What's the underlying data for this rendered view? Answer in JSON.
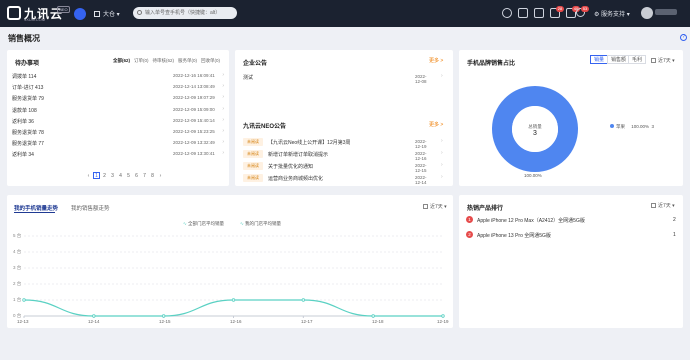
{
  "header": {
    "logo_text": "九讯云",
    "logo_sub": "9XUN.COM",
    "logo_badge": "NEO",
    "store_label": "大仓",
    "search_placeholder": "输入单号查手机号（快捷键：alt）",
    "badges": [
      "28",
      "40",
      "53"
    ],
    "service_label": "服务支持"
  },
  "page": {
    "title": "销售概况",
    "help": "?"
  },
  "todo": {
    "title": "待办事项",
    "tabs": [
      {
        "label": "全部(62)",
        "active": true
      },
      {
        "label": "订单(0)",
        "active": false
      },
      {
        "label": "待审核(62)",
        "active": false
      },
      {
        "label": "服务单(0)",
        "active": false
      },
      {
        "label": "回收单(0)",
        "active": false
      }
    ],
    "items": [
      {
        "label": "调拨单 114",
        "date": "2022-12-16 16:09:41"
      },
      {
        "label": "订单-进订 413",
        "date": "2022-12-14 13:08:49"
      },
      {
        "label": "服务退货单 79",
        "date": "2022-12-09 19:07:29"
      },
      {
        "label": "退款单 108",
        "date": "2022-12-09 15:09:00"
      },
      {
        "label": "返利单 36",
        "date": "2022-12-09 15:40:14"
      },
      {
        "label": "服务退货单 78",
        "date": "2022-12-09 15:23:25"
      },
      {
        "label": "服务退货单 77",
        "date": "2022-12-09 13:32:49"
      },
      {
        "label": "返利单 34",
        "date": "2022-12-09 13:30:41"
      }
    ],
    "pager": [
      "‹",
      "1",
      "2",
      "3",
      "4",
      "5",
      "6",
      "7",
      "8",
      "›"
    ],
    "current_page": "1"
  },
  "notice": {
    "title": "企业公告",
    "more": "更多 >",
    "items": [
      {
        "text": "测试",
        "date": "2022-12-08"
      }
    ]
  },
  "neo": {
    "title": "九讯云NEO公告",
    "more": "更多 >",
    "items": [
      {
        "tag": "未阅读",
        "text": "【九讯云Neo线上公开课】12月第3周",
        "date": "2022-12-19"
      },
      {
        "tag": "未阅读",
        "text": "新增订单新增订单取消提示",
        "date": "2022-12-16"
      },
      {
        "tag": "未阅读",
        "text": "关于批量优化的通知",
        "date": "2022-12-15"
      },
      {
        "tag": "未阅读",
        "text": "运营商业务商城频出优化",
        "date": "2022-12-14"
      }
    ]
  },
  "brand": {
    "title": "手机品牌销售占比",
    "segments": [
      "销量",
      "销售额",
      "毛利"
    ],
    "active_segment": "销量",
    "date_label": "近7天",
    "center_label": "总销量",
    "center_value": "3",
    "legend_name": "苹果",
    "legend_pct": "100.00%",
    "legend_val": "3",
    "outer_label": "100.00%",
    "color": "#4f86f0"
  },
  "trend": {
    "tabs": [
      "我的手机销量走势",
      "我的销售额走势"
    ],
    "date_label": "近7天",
    "legend": [
      "全部门店平均销量",
      "我的门店平均销量"
    ],
    "line_color": "#5ad1c3"
  },
  "ranking": {
    "title": "热销产品排行",
    "date_label": "近7天",
    "items": [
      {
        "rank": "1",
        "name": "Apple iPhone 12 Pro Max（A2412）全网通5G版",
        "qty": "2"
      },
      {
        "rank": "2",
        "name": "Apple iPhone 13 Pro 全网通5G版",
        "qty": "1"
      }
    ]
  },
  "chart_data": {
    "type": "line",
    "x": [
      "12-13",
      "12-14",
      "12-15",
      "12-16",
      "12-17",
      "12-18",
      "12-19"
    ],
    "yticks": [
      "5 台",
      "4 台",
      "3 台",
      "2 台",
      "1 台",
      "0 台"
    ],
    "ylim": [
      0,
      5
    ],
    "series": [
      {
        "name": "我的门店平均销量",
        "values": [
          1,
          0,
          0,
          1,
          1,
          0,
          0
        ]
      }
    ]
  }
}
